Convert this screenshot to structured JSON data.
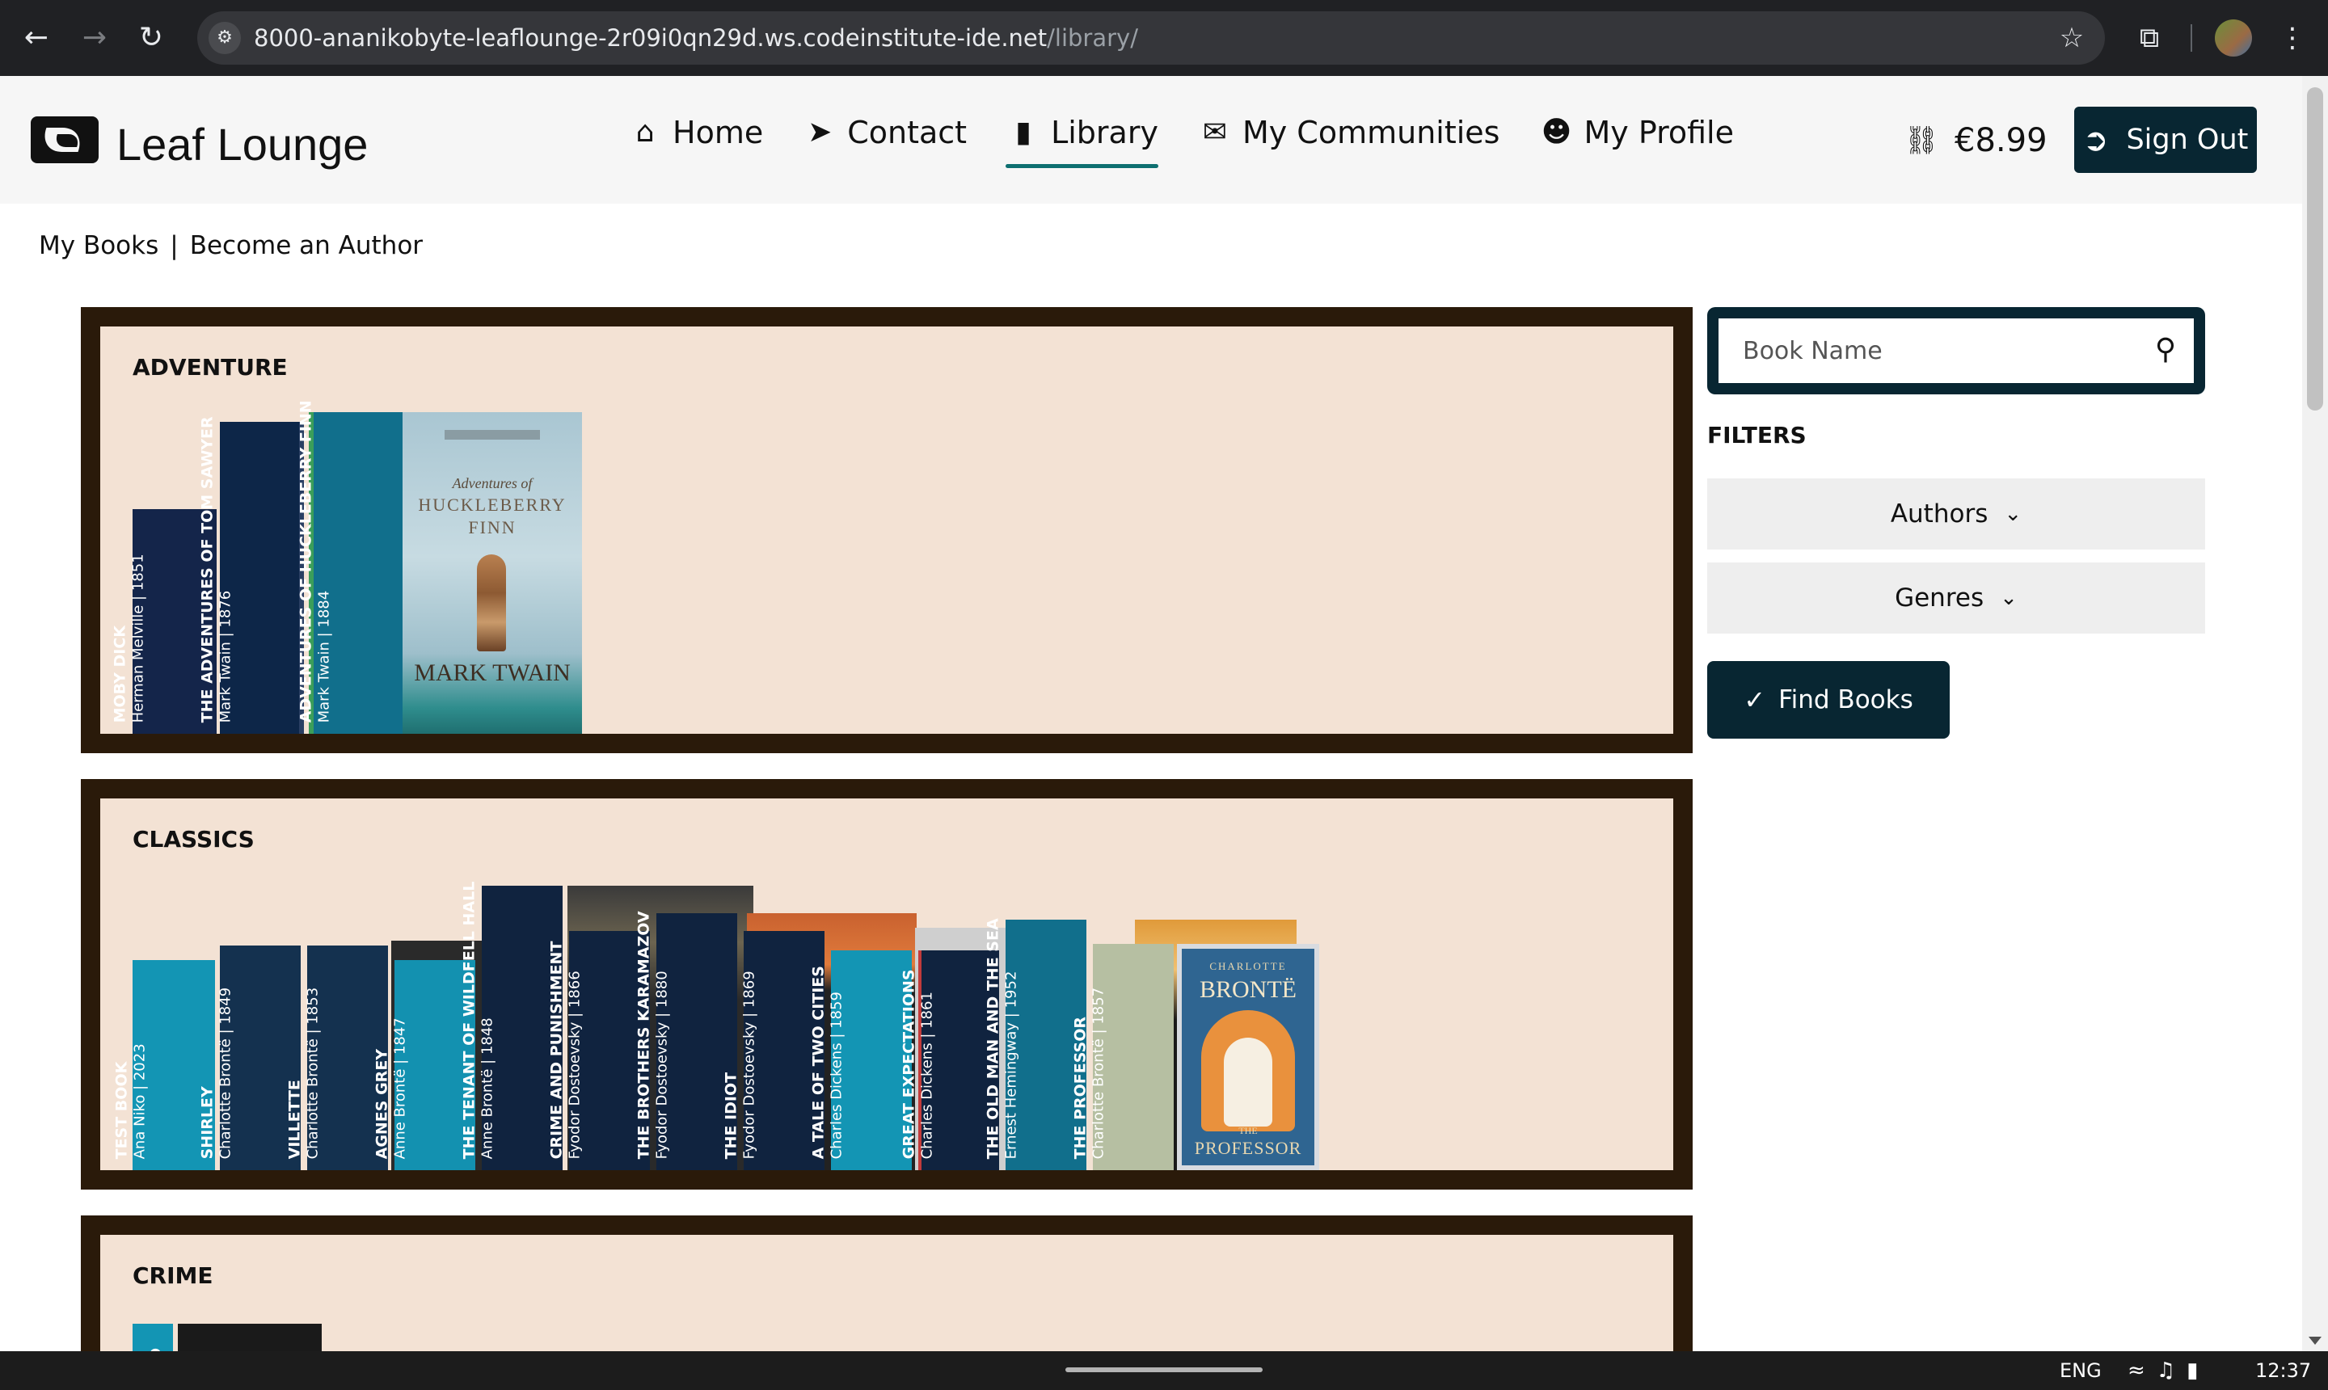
{
  "browser": {
    "url_host": "8000-ananikobyte-leaflounge-2r09i0qn29d.ws.codeinstitute-ide.net",
    "url_path": "/library/"
  },
  "header": {
    "brand": "Leaf Lounge",
    "nav": [
      {
        "label": "Home",
        "icon": "home-icon"
      },
      {
        "label": "Contact",
        "icon": "paper-plane-icon"
      },
      {
        "label": "Library",
        "icon": "book-icon",
        "active": true
      },
      {
        "label": "My Communities",
        "icon": "comments-icon"
      },
      {
        "label": "My Profile",
        "icon": "user-icon"
      }
    ],
    "cart_total": "€8.99",
    "sign_out": "Sign Out"
  },
  "subnav": {
    "my_books": "My Books",
    "separator": "|",
    "become_author": "Become an Author"
  },
  "shelves": [
    {
      "genre": "ADVENTURE",
      "books": [
        {
          "title": "MOBY DICK",
          "meta": "Herman Melville | 1851",
          "color": "#14254a"
        },
        {
          "title": "THE ADVENTURES OF TOM SAWYER",
          "meta": "Mark Twain | 1876",
          "color": "#0d2648"
        },
        {
          "title": "ADVENTURES OF HUCKLEBERRY FINN",
          "meta": "Mark Twain | 1884",
          "color": "#116f8c"
        }
      ],
      "cover": {
        "top_text": "Adventures of",
        "title_line1": "HUCKLEBERRY",
        "title_line2": "FINN",
        "author": "MARK TWAIN"
      }
    },
    {
      "genre": "CLASSICS",
      "books": [
        {
          "title": "TEST BOOK",
          "meta": "Ana Niko | 2023",
          "color": "#1395b4"
        },
        {
          "title": "SHIRLEY",
          "meta": "Charlotte Brontë | 1849",
          "color": "#14314f"
        },
        {
          "title": "VILLETTE",
          "meta": "Charlotte Brontë | 1853",
          "color": "#14314f"
        },
        {
          "title": "AGNES GREY",
          "meta": "Anne Brontë | 1847",
          "color": "#1391b0"
        },
        {
          "title": "THE TENANT OF WILDFELL HALL",
          "meta": "Anne Brontë | 1848",
          "color": "#10233f"
        },
        {
          "title": "CRIME AND PUNISHMENT",
          "meta": "Fyodor Dostoevsky | 1866",
          "color": "#10233f"
        },
        {
          "title": "THE BROTHERS KARAMAZOV",
          "meta": "Fyodor Dostoevsky | 1880",
          "color": "#10233f"
        },
        {
          "title": "THE IDIOT",
          "meta": "Fyodor Dostoevsky | 1869",
          "color": "#10233f"
        },
        {
          "title": "A TALE OF TWO CITIES",
          "meta": "Charles Dickens | 1859",
          "color": "#1395b4"
        },
        {
          "title": "GREAT EXPECTATIONS",
          "meta": "Charles Dickens | 1861",
          "color": "#10233f"
        },
        {
          "title": "THE OLD MAN AND THE SEA",
          "meta": "Ernest Hemingway | 1952",
          "color": "#116f8c"
        },
        {
          "title": "THE PROFESSOR",
          "meta": "Charlotte Brontë | 1857",
          "color": "#b6bfa2"
        }
      ],
      "cover": {
        "top_text": "CHARLOTTE",
        "title_line1": "BRONTË",
        "title_line2": "THE",
        "author": "PROFESSOR"
      }
    },
    {
      "genre": "CRIME",
      "books": [
        {
          "title": "RD",
          "meta": "",
          "color": "#1395b4"
        }
      ]
    }
  ],
  "sidebar": {
    "search_placeholder": "Book Name",
    "filters_title": "FILTERS",
    "authors_label": "Authors",
    "genres_label": "Genres",
    "find_label": "Find Books"
  },
  "taskbar": {
    "lang": "ENG",
    "time": "12:37"
  }
}
